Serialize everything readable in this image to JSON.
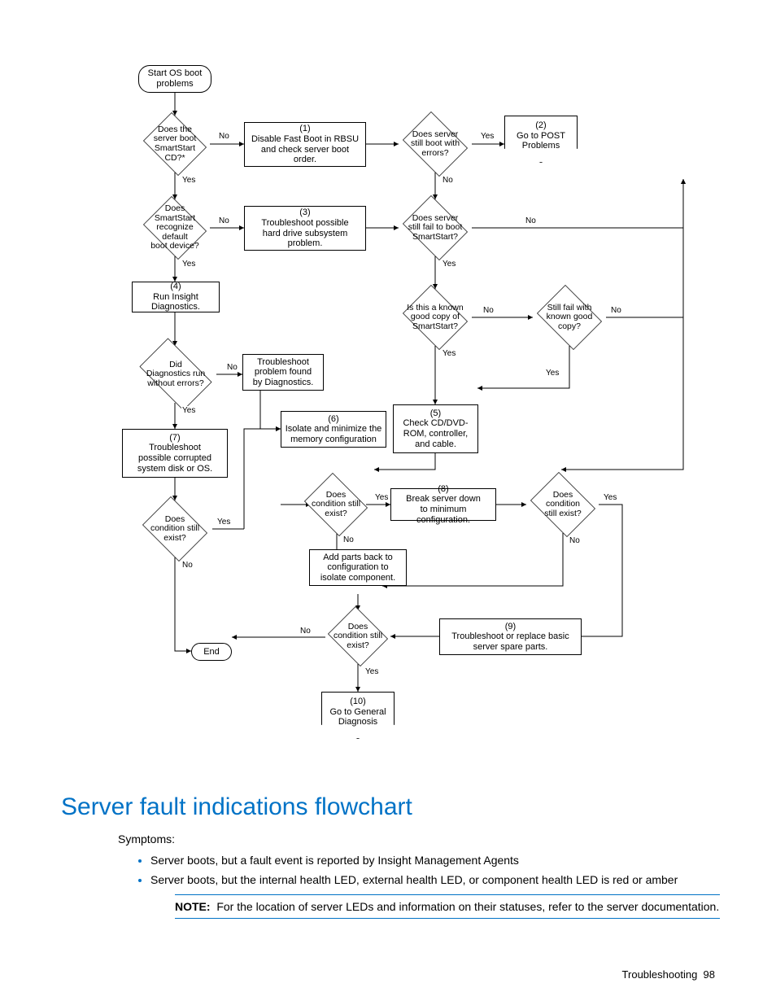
{
  "footer": {
    "section": "Troubleshooting",
    "page": "98"
  },
  "heading": "Server fault indications flowchart",
  "symptoms_label": "Symptoms:",
  "bullets": [
    "Server boots, but a fault event is reported by Insight Management Agents",
    "Server boots, but the internal health LED, external health LED, or component health LED is red or amber"
  ],
  "note_label": "NOTE:",
  "note_text": "For the location of server LEDs and information on their statuses, refer to the server documentation.",
  "nodes": {
    "start": "Start OS boot\nproblems",
    "q_bootcd": "Does the\nserver boot\nSmartStart\nCD?*",
    "p1": "(1)\nDisable Fast Boot in RBSU\nand check server boot\norder.",
    "q_errors": "Does server\nstill boot with\nerrors?",
    "o2": "(2)\nGo to POST\nProblems",
    "q_recdev": "Does\nSmartStart\nrecognize default\nboot device?",
    "p3": "(3)\nTroubleshoot possible\nhard drive subsystem\nproblem.",
    "q_failboot": "Does server\nstill fail to boot\nSmartStart?",
    "p4": "(4)\nRun Insight\nDiagnostics.",
    "q_known": "Is this a known\ngood copy of\nSmartStart?",
    "q_stillfail": "Still fail with\nknown good\ncopy?",
    "q_diagerr": "Did\nDiagnostics run\nwithout errors?",
    "p_diagfound": "Troubleshoot\nproblem found\nby Diagnostics.",
    "p5": "(5)\nCheck CD/DVD-\nROM, controller,\nand cable.",
    "p6": "(6)\nIsolate and minimize the\nmemory configuration",
    "p7": "(7)\nTroubleshoot\npossible corrupted\nsystem disk or OS.",
    "q_cond6": "Does\ncondition still\nexist?",
    "p8": "(8)\nBreak server down\nto minimum configuration.",
    "q_cond8": "Does\ncondition\nstill exist?",
    "q_cond7": "Does\ncondition still\nexist?",
    "p_addback": "Add parts back to\nconfiguration to\nisolate component.",
    "end": "End",
    "q_condfinal": "Does\ncondition still\nexist?",
    "p9": "(9)\nTroubleshoot or replace basic\nserver spare parts.",
    "o10": "(10)\nGo to General\nDiagnosis"
  },
  "labels": {
    "yes": "Yes",
    "no": "No"
  }
}
